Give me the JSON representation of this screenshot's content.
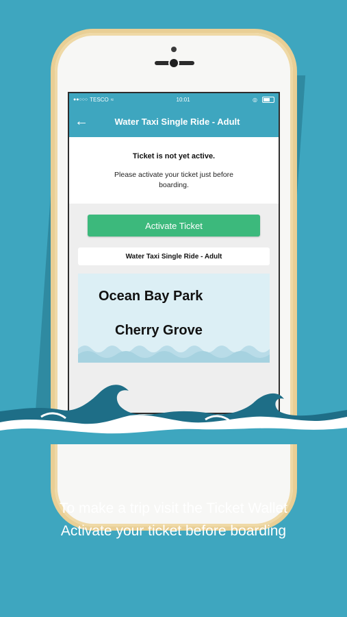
{
  "status_bar": {
    "carrier": "TESCO",
    "time": "10:01"
  },
  "nav": {
    "title": "Water Taxi Single Ride - Adult",
    "back_icon": "arrow-left-icon"
  },
  "info": {
    "title": "Ticket is not yet active.",
    "message": "Please activate your ticket just before boarding."
  },
  "activate_button": "Activate Ticket",
  "ticket": {
    "name": "Water Taxi Single Ride - Adult",
    "from": "Ocean Bay Park",
    "to": "Cherry Grove"
  },
  "caption": {
    "line1": "To make a trip visit the Ticket Wallet",
    "line2": "Activate your ticket before boarding"
  },
  "colors": {
    "background": "#3ea6bf",
    "header": "#3ea6bf",
    "button": "#3cb97c",
    "wave_dark": "#1e6e87",
    "phone_frame": "#efd9a6"
  }
}
